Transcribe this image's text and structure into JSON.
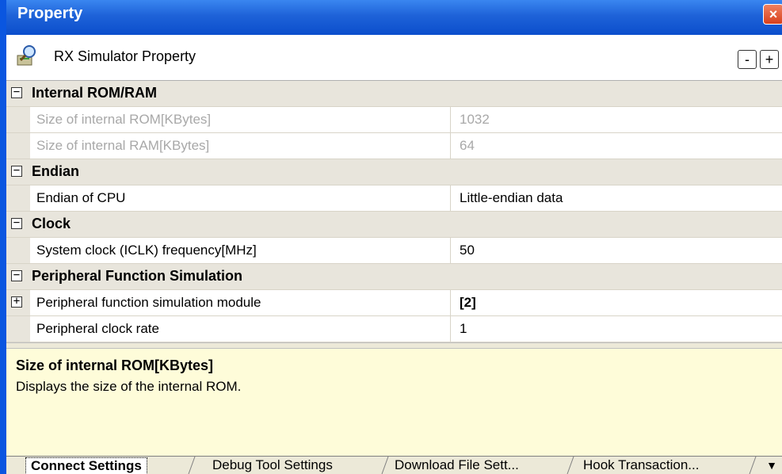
{
  "window": {
    "title": "Property",
    "close_symbol": "×"
  },
  "header": {
    "title": "RX Simulator Property",
    "collapse_label": "-",
    "expand_label": "+"
  },
  "categories": [
    {
      "label": "Internal ROM/RAM",
      "toggle": "−",
      "properties": [
        {
          "name": "Size of internal ROM[KBytes]",
          "value": "1032"
        },
        {
          "name": "Size of internal RAM[KBytes]",
          "value": "64"
        }
      ]
    },
    {
      "label": "Endian",
      "toggle": "−",
      "properties": [
        {
          "name": "Endian of CPU",
          "value": "Little-endian data"
        }
      ]
    },
    {
      "label": "Clock",
      "toggle": "−",
      "properties": [
        {
          "name": "System clock (ICLK) frequency[MHz]",
          "value": "50"
        }
      ]
    },
    {
      "label": "Peripheral Function Simulation",
      "toggle": "−",
      "properties": [
        {
          "name": "Peripheral function simulation module",
          "value": "[2]",
          "toggle": "+"
        },
        {
          "name": "Peripheral clock rate",
          "value": "1"
        }
      ]
    }
  ],
  "description": {
    "title": "Size of internal ROM[KBytes]",
    "text": "Displays the size of the internal ROM."
  },
  "tabs": [
    {
      "label": "Connect Settings"
    },
    {
      "label": "Debug Tool Settings"
    },
    {
      "label": "Download File Sett..."
    },
    {
      "label": "Hook Transaction..."
    }
  ],
  "tab_more_symbol": "▼",
  "colors": {
    "titlebar": "#1e62d8",
    "category_bg": "#e8e5dc",
    "description_bg": "#fefcd9",
    "disabled_text": "#a8a8a8"
  },
  "icons": {
    "header": "property-magnifier-icon"
  }
}
